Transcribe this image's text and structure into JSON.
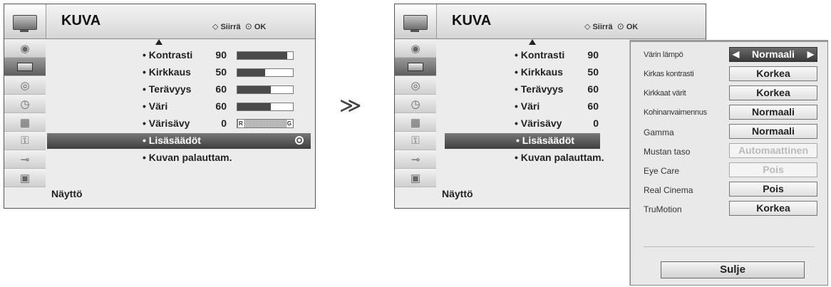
{
  "menu": {
    "title": "KUVA",
    "hint_move_icon": "four-way-arrow-icon",
    "hint_move": "Siirrä",
    "hint_ok_icon": "ok-circle-icon",
    "hint_ok": "OK",
    "footer": "Näyttö",
    "sidebar_icons": [
      "antenna-icon",
      "picture-tv-icon",
      "audio-speaker-icon",
      "clock-icon",
      "lock-option-icon",
      "padlock-icon",
      "input-plug-icon",
      "screen-photo-icon"
    ],
    "sidebar_selected_index": 1,
    "items": [
      {
        "label": "• Kontrasti",
        "value": "90",
        "level": 90
      },
      {
        "label": "• Kirkkaus",
        "value": "50",
        "level": 50
      },
      {
        "label": "• Terävyys",
        "value": "60",
        "level": 60
      },
      {
        "label": "• Väri",
        "value": "60",
        "level": 60
      },
      {
        "label": "• Värisävy",
        "value": "0",
        "tint_left": "R",
        "tint_right": "G"
      },
      {
        "label": "• Lisäsäädöt"
      },
      {
        "label": "• Kuvan palauttam."
      }
    ],
    "selected_item": "• Lisäsäädöt"
  },
  "step_arrow": "≫",
  "popup": {
    "rows": [
      {
        "label": "Värin lämpö",
        "value": "Normaali",
        "selected": true
      },
      {
        "label": "Kirkas kontrasti",
        "value": "Korkea"
      },
      {
        "label": "Kirkkaat värit",
        "value": "Korkea"
      },
      {
        "label": "Kohinanvaimennus",
        "value": "Normaali"
      },
      {
        "label": "Gamma",
        "value": "Normaali"
      },
      {
        "label": "Mustan taso",
        "value": "Automaattinen",
        "disabled": true
      },
      {
        "label": "Eye Care",
        "value": "Pois",
        "disabled": true
      },
      {
        "label": "Real Cinema",
        "value": "Pois"
      },
      {
        "label": "TruMotion",
        "value": "Korkea"
      }
    ],
    "close_label": "Sulje"
  }
}
